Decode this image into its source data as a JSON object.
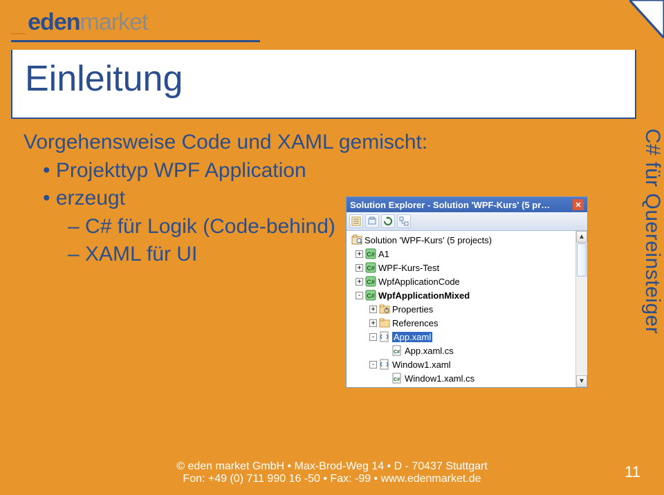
{
  "logo": {
    "prefix": "_",
    "part1": "eden",
    "part2": "market"
  },
  "title": "Einleitung",
  "content": {
    "intro": "Vorgehensweise Code und XAML gemischt:",
    "b1": "Projekttyp WPF Application",
    "b2": "erzeugt",
    "s1": "C# für Logik (Code-behind)",
    "s2": "XAML für UI"
  },
  "sidebar": "C# für Quereinsteiger",
  "footer": {
    "line1": "© eden market GmbH • Max-Brod-Weg 14 • D - 70437 Stuttgart",
    "line2": "Fon: +49 (0) 711 990 16 -50 • Fax: -99 • www.edenmarket.de"
  },
  "page": "11",
  "solexp": {
    "title": "Solution Explorer - Solution 'WPF-Kurs' (5 pr…",
    "close": "✕",
    "tree": {
      "root": "Solution 'WPF-Kurs' (5 projects)",
      "items": [
        {
          "name": "A1",
          "type": "prj",
          "exp": "+"
        },
        {
          "name": "WPF-Kurs-Test",
          "type": "prj",
          "exp": "+"
        },
        {
          "name": "WpfApplicationCode",
          "type": "prj",
          "exp": "+"
        },
        {
          "name": "WpfApplicationMixed",
          "type": "prj",
          "exp": "-",
          "bold": true,
          "children": [
            {
              "name": "Properties",
              "type": "fold",
              "exp": "+"
            },
            {
              "name": "References",
              "type": "fold",
              "exp": "+"
            },
            {
              "name": "App.xaml",
              "type": "xaml",
              "exp": "-",
              "selected": true,
              "children": [
                {
                  "name": "App.xaml.cs",
                  "type": "cs"
                }
              ]
            },
            {
              "name": "Window1.xaml",
              "type": "xaml",
              "exp": "-",
              "children": [
                {
                  "name": "Window1.xaml.cs",
                  "type": "cs"
                }
              ]
            }
          ]
        }
      ]
    },
    "scroll": {
      "up": "▲",
      "down": "▼"
    }
  }
}
